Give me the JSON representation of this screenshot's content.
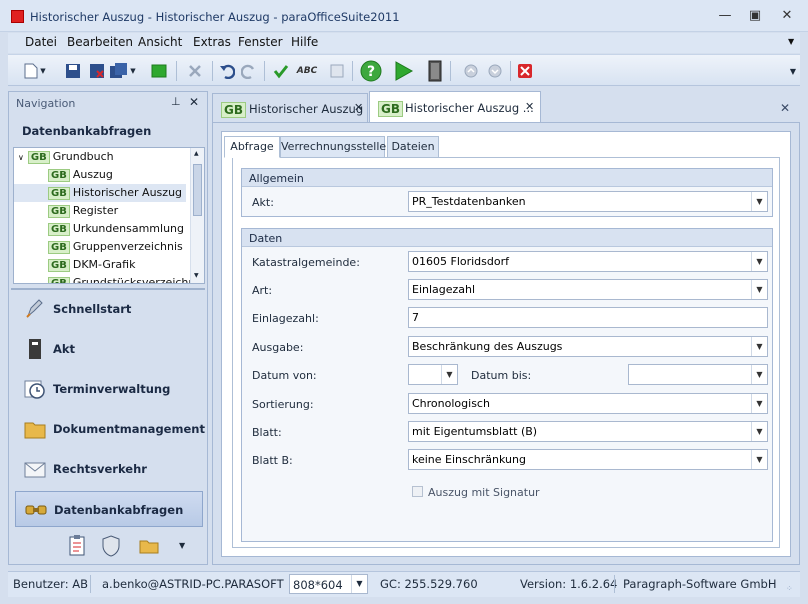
{
  "window": {
    "title": "Historischer Auszug - Historischer Auszug - paraOfficeSuite2011"
  },
  "menu": [
    "Datei",
    "Bearbeiten",
    "Ansicht",
    "Extras",
    "Fenster",
    "Hilfe"
  ],
  "navigation": {
    "header": "Navigation",
    "section_title": "Datenbankabfragen",
    "tree": {
      "root": {
        "badge": "GB",
        "label": "Grundbuch"
      },
      "items": [
        {
          "badge": "GB",
          "label": "Auszug"
        },
        {
          "badge": "GB",
          "label": "Historischer Auszug"
        },
        {
          "badge": "GB",
          "label": "Register"
        },
        {
          "badge": "GB",
          "label": "Urkundensammlung"
        },
        {
          "badge": "GB",
          "label": "Gruppenverzeichnis"
        },
        {
          "badge": "GB",
          "label": "DKM-Grafik"
        },
        {
          "badge": "GB",
          "label": "Grundstücksverzeichnis"
        }
      ]
    },
    "buttons": [
      "Schnellstart",
      "Akt",
      "Terminverwaltung",
      "Dokumentmanagement",
      "Rechtsverkehr",
      "Datenbankabfragen"
    ]
  },
  "doc_tabs": [
    {
      "badge": "GB",
      "label": "Historischer Auszug"
    },
    {
      "badge": "GB",
      "label": "Historischer Auszug ..."
    }
  ],
  "inner_tabs": [
    "Abfrage",
    "Verrechnungsstelle",
    "Dateien"
  ],
  "form": {
    "allgemein": {
      "title": "Allgemein",
      "akt_label": "Akt:",
      "akt_value": "PR_Testdatenbanken"
    },
    "daten": {
      "title": "Daten",
      "katastral_label": "Katastralgemeinde:",
      "katastral_value": "01605 Floridsdorf",
      "art_label": "Art:",
      "art_value": "Einlagezahl",
      "einlage_label": "Einlagezahl:",
      "einlage_value": "7",
      "ausgabe_label": "Ausgabe:",
      "ausgabe_value": "Beschränkung des Auszugs",
      "datum_von_label": "Datum von:",
      "datum_von_value": "",
      "datum_bis_label": "Datum bis:",
      "datum_bis_value": "",
      "sortierung_label": "Sortierung:",
      "sortierung_value": "Chronologisch",
      "blatt_label": "Blatt:",
      "blatt_value": "mit Eigentumsblatt (B)",
      "blatt_b_label": "Blatt B:",
      "blatt_b_value": "keine Einschränkung",
      "signatur_label": "Auszug mit Signatur",
      "signatur_checked": false
    }
  },
  "status": {
    "user": "Benutzer: AB",
    "account": "a.benko@ASTRID-PC.PARASOFT",
    "resolution": "808*604",
    "gc": "GC: 255.529.760",
    "version": "Version: 1.6.2.64",
    "company": "Paragraph-Software GmbH"
  },
  "colors": {
    "accent": "#2d6b1e",
    "frame": "#d5dfee",
    "close_red": "#d8272b"
  }
}
